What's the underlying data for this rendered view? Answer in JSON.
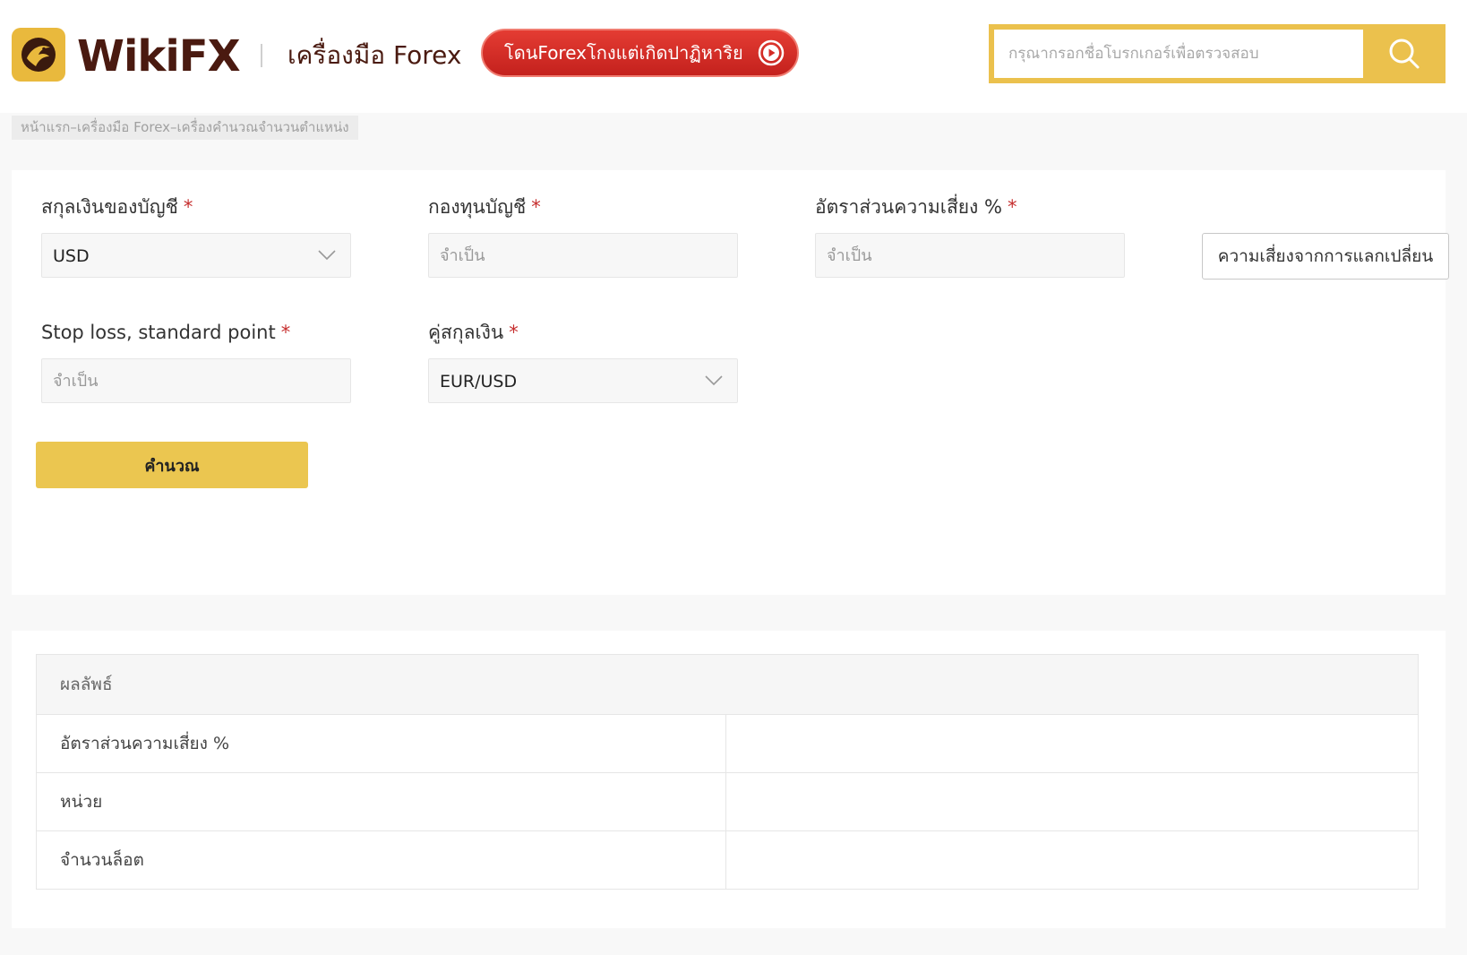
{
  "header": {
    "brand": "WikiFX",
    "tools_title": "เครื่องมือ Forex",
    "promo_text": "โดนForexโกงแต่เกิดปาฏิหาริย",
    "search_placeholder": "กรุณากรอกชื่อโบรกเกอร์เพื่อตรวจสอบ",
    "colors": {
      "brand": "#4a1a10",
      "accent": "#ebc14d",
      "promo": "#d42b26"
    }
  },
  "breadcrumb": "หน้าแรก–เครื่องมือ Forex–เครื่องคำนวณจำนวนตำแหน่ง",
  "form": {
    "account_currency": {
      "label": "สกุลเงินของบัญชี",
      "required": "*",
      "value": "USD"
    },
    "account_fund": {
      "label": "กองทุนบัญชี",
      "required": "*",
      "placeholder": "จำเป็น"
    },
    "risk_ratio": {
      "label": "อัตราส่วนความเสี่ยง %",
      "required": "*",
      "placeholder": "จำเป็น"
    },
    "exchange_risk_button": "ความเสี่ยงจากการแลกเปลี่ยน",
    "stop_loss": {
      "label": "Stop loss, standard point",
      "required": "*",
      "placeholder": "จำเป็น"
    },
    "currency_pair": {
      "label": "คู่สกุลเงิน",
      "required": "*",
      "value": "EUR/USD"
    },
    "calculate_button": "คำนวณ"
  },
  "result": {
    "header": "ผลลัพธ์",
    "rows": [
      {
        "label": "อัตราส่วนความเสี่ยง %",
        "value": ""
      },
      {
        "label": "หน่วย",
        "value": ""
      },
      {
        "label": "จำนวนล็อต",
        "value": ""
      }
    ]
  }
}
